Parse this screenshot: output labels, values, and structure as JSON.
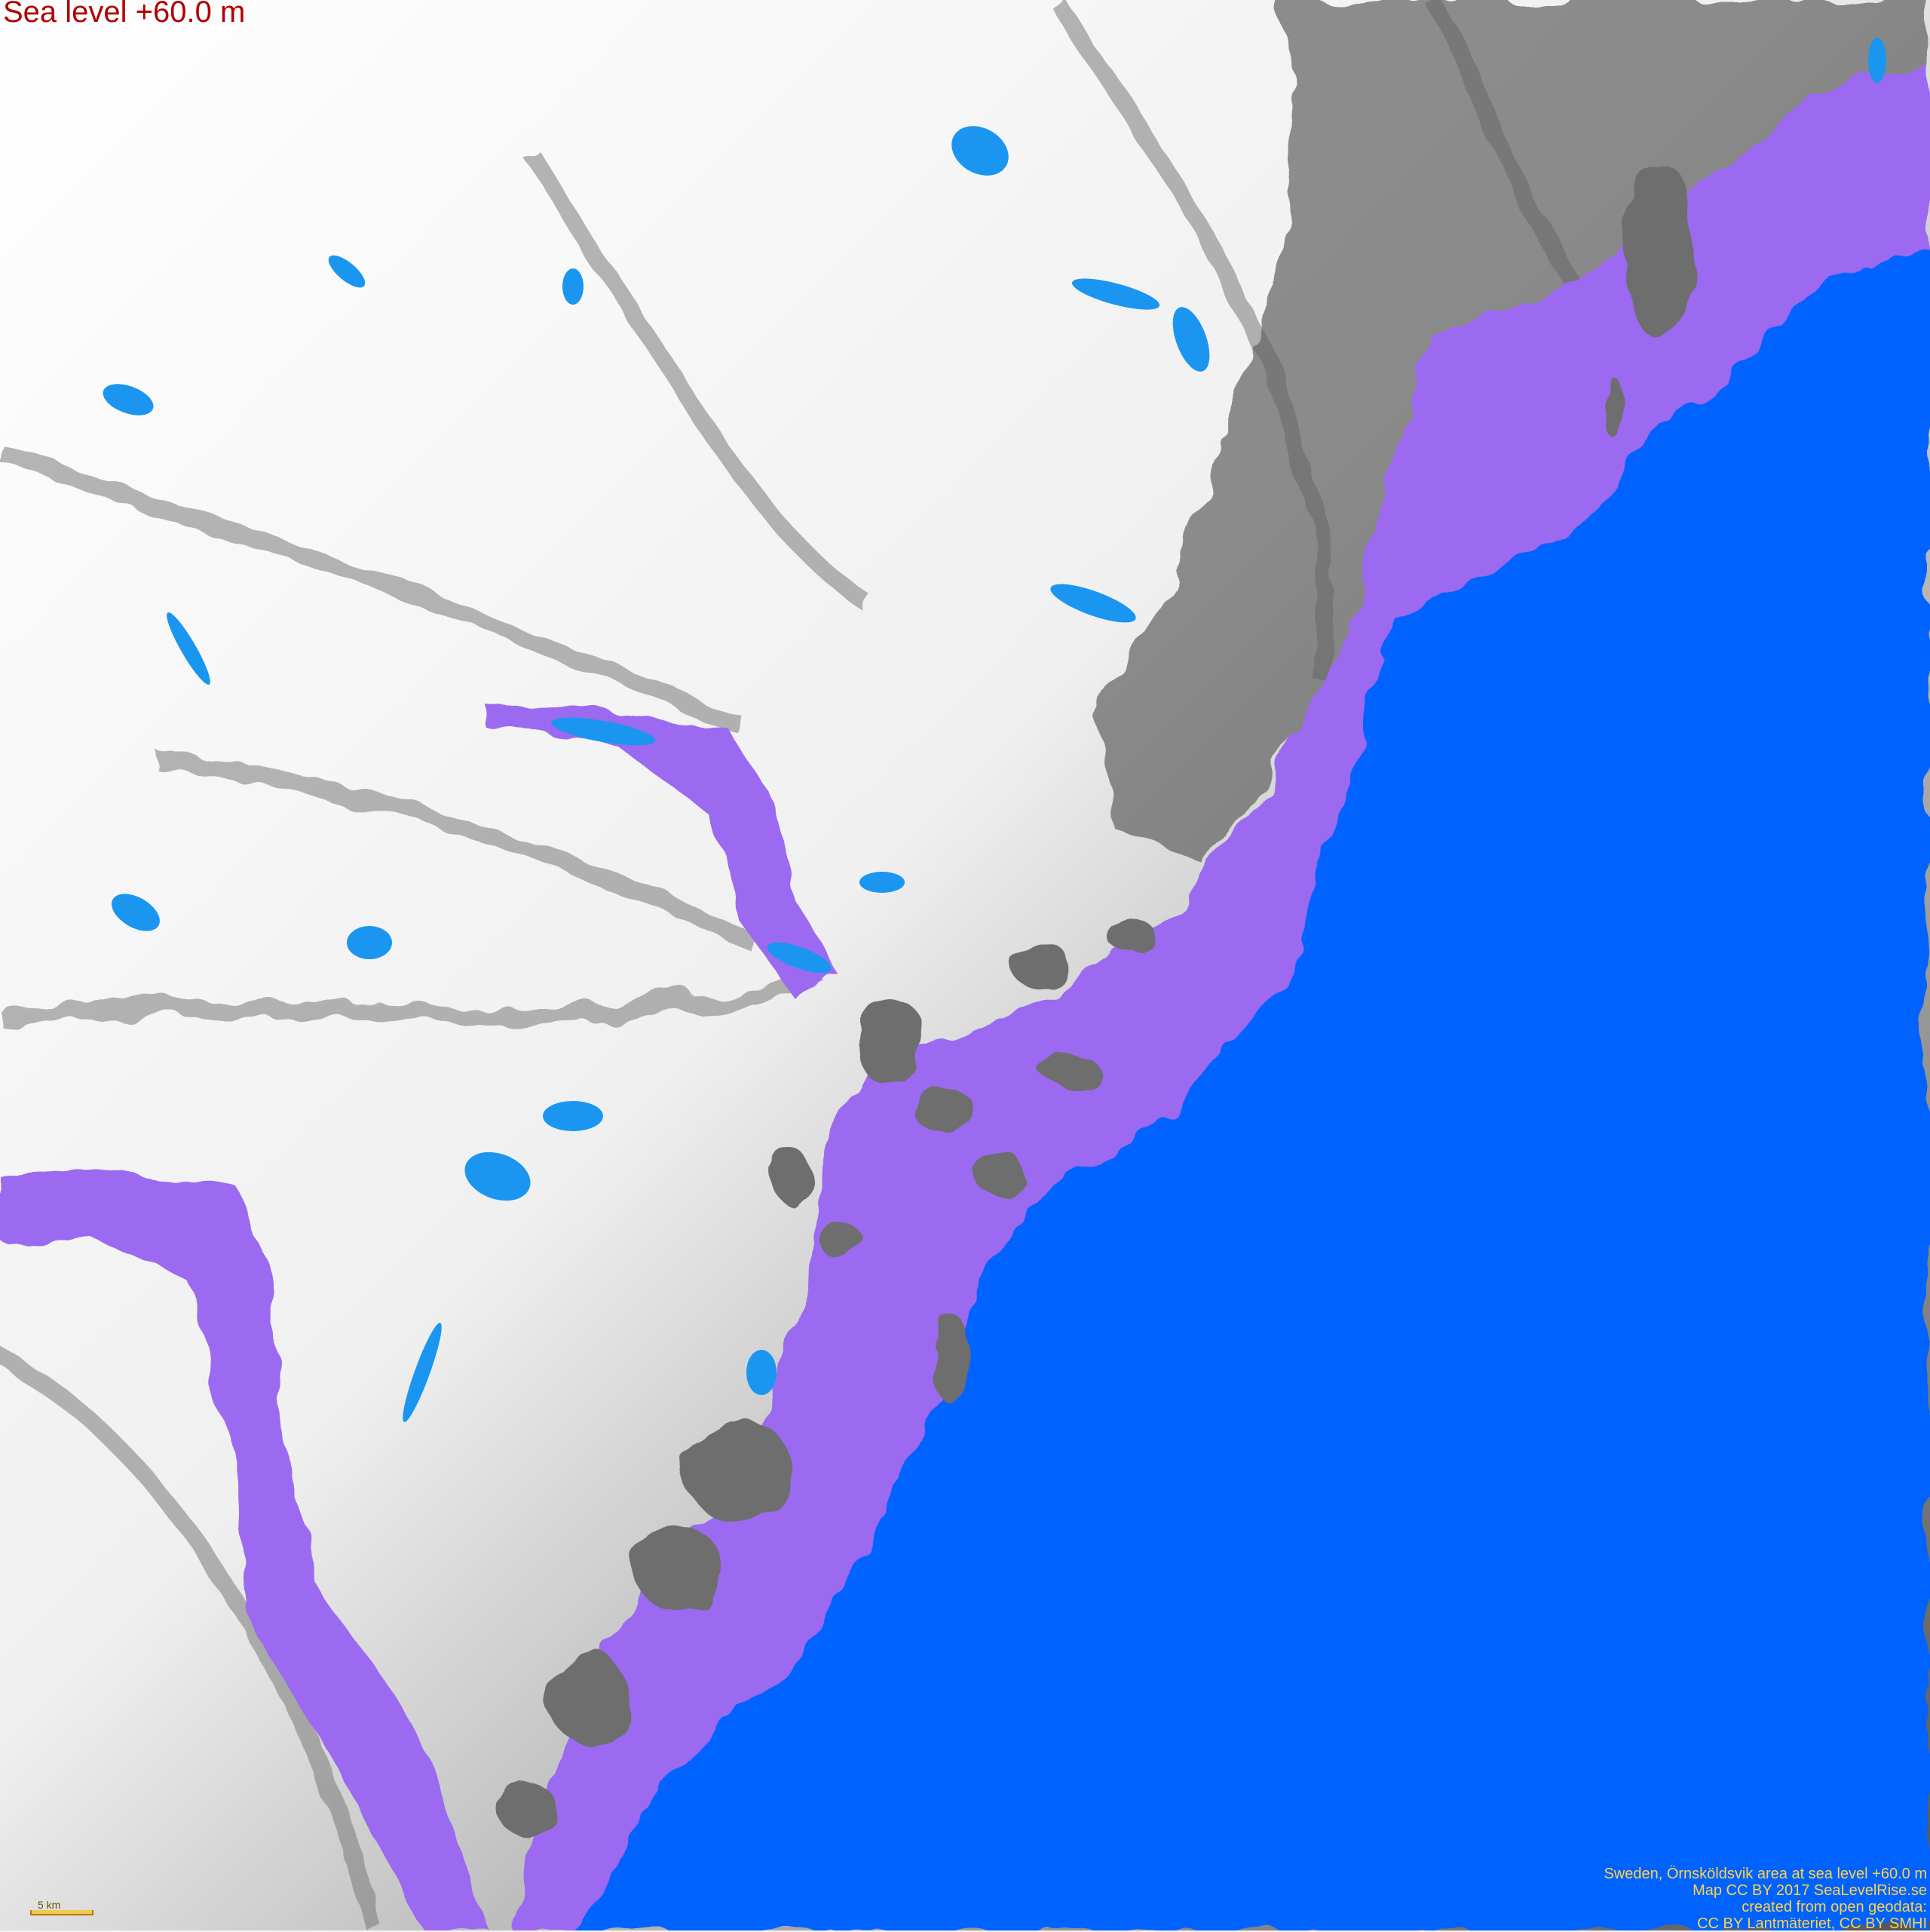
{
  "map": {
    "title": "Sea level +60.0 m",
    "sea_level_m": 60.0,
    "colors": {
      "sea": "#0064ff",
      "flooded_land": "#9b6af0",
      "lakes": "#1a96f0",
      "high_terrain": "#ffffff",
      "low_terrain": "#5a5a5a"
    }
  },
  "scale": {
    "label": "5 km"
  },
  "credits": [
    "Sweden, Örnsköldsvik area at sea level +60.0 m",
    "Map CC BY 2017 SeaLevelRise.se",
    "created from open geodata:",
    "CC BY Lantmäteriet, CC BY SMHI"
  ]
}
